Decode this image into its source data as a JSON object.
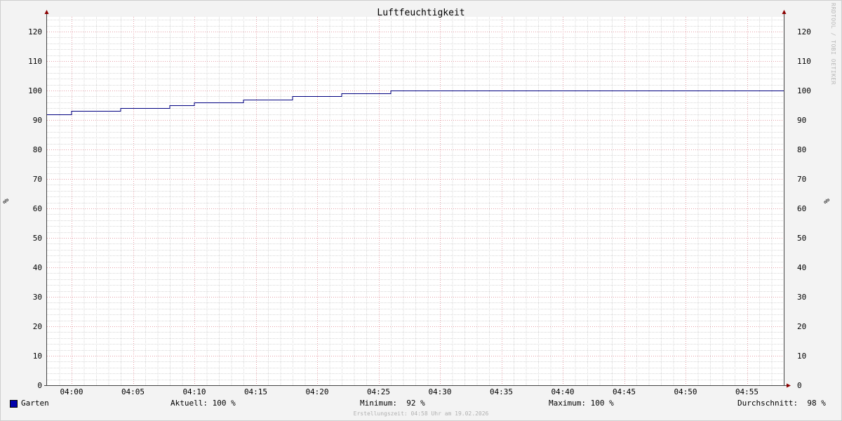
{
  "chart_data": {
    "type": "line",
    "title": "Luftfeuchtigkeit",
    "ylabel_left": "%",
    "ylabel_right": "%",
    "ylim": [
      0,
      125
    ],
    "yticks": [
      0,
      10,
      20,
      30,
      40,
      50,
      60,
      70,
      80,
      90,
      100,
      110,
      120
    ],
    "xlim": [
      "03:58",
      "04:58"
    ],
    "xtick_labels": [
      "04:00",
      "04:05",
      "04:10",
      "04:15",
      "04:20",
      "04:25",
      "04:30",
      "04:35",
      "04:40",
      "04:45",
      "04:50",
      "04:55"
    ],
    "grid": true,
    "step": true,
    "series": [
      {
        "name": "Garten",
        "color": "#000080",
        "x": [
          "03:58",
          "04:00",
          "04:04",
          "04:08",
          "04:10",
          "04:14",
          "04:18",
          "04:22",
          "04:26",
          "04:58"
        ],
        "values": [
          92,
          93,
          94,
          95,
          96,
          97,
          98,
          99,
          100,
          100
        ]
      }
    ]
  },
  "watermark": "RRDTOOL / TOBI OETIKER",
  "legend": {
    "series_label": "Garten",
    "swatch_color": "#0000aa",
    "current": "Aktuell: 100 %",
    "minimum": "Minimum:  92 %",
    "maximum": "Maximum: 100 %",
    "average": "Durchschnitt:  98 %"
  },
  "footer": "Erstellungszeit: 04:58 Uhr am 19.02.2026"
}
